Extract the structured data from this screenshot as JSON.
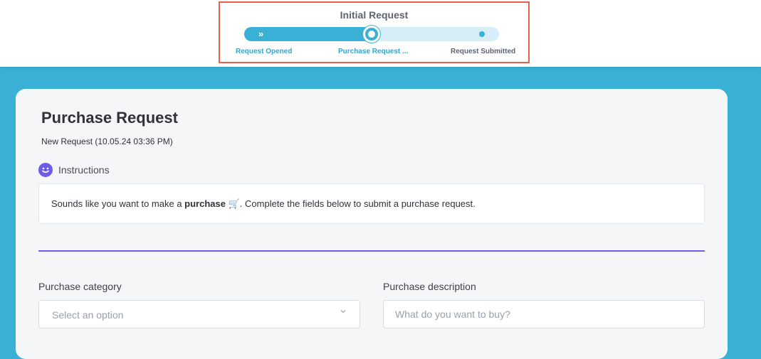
{
  "stepper": {
    "title": "Initial Request",
    "progress": 0.5,
    "steps": [
      {
        "label": "Request Opened",
        "state": "done"
      },
      {
        "label": "Purchase Request ...",
        "state": "current"
      },
      {
        "label": "Request Submitted",
        "state": "upcoming"
      }
    ]
  },
  "form": {
    "title": "Purchase Request",
    "subtitle": "New Request (10.05.24 03:36 PM)",
    "instructions": {
      "label": "Instructions",
      "icon": "smiley-icon",
      "text_before": "Sounds like you want to make a ",
      "text_bold": "purchase",
      "text_emoji": "🛒",
      "text_after": ". Complete the fields below to submit a purchase request."
    },
    "fields": {
      "category": {
        "label": "Purchase category",
        "placeholder": "Select an option"
      },
      "description": {
        "label": "Purchase description",
        "placeholder": "What do you want to buy?",
        "value": ""
      }
    }
  },
  "colors": {
    "background": "#3ab0d6",
    "accent": "#6c5ce7",
    "highlight_border": "#e8604c"
  }
}
